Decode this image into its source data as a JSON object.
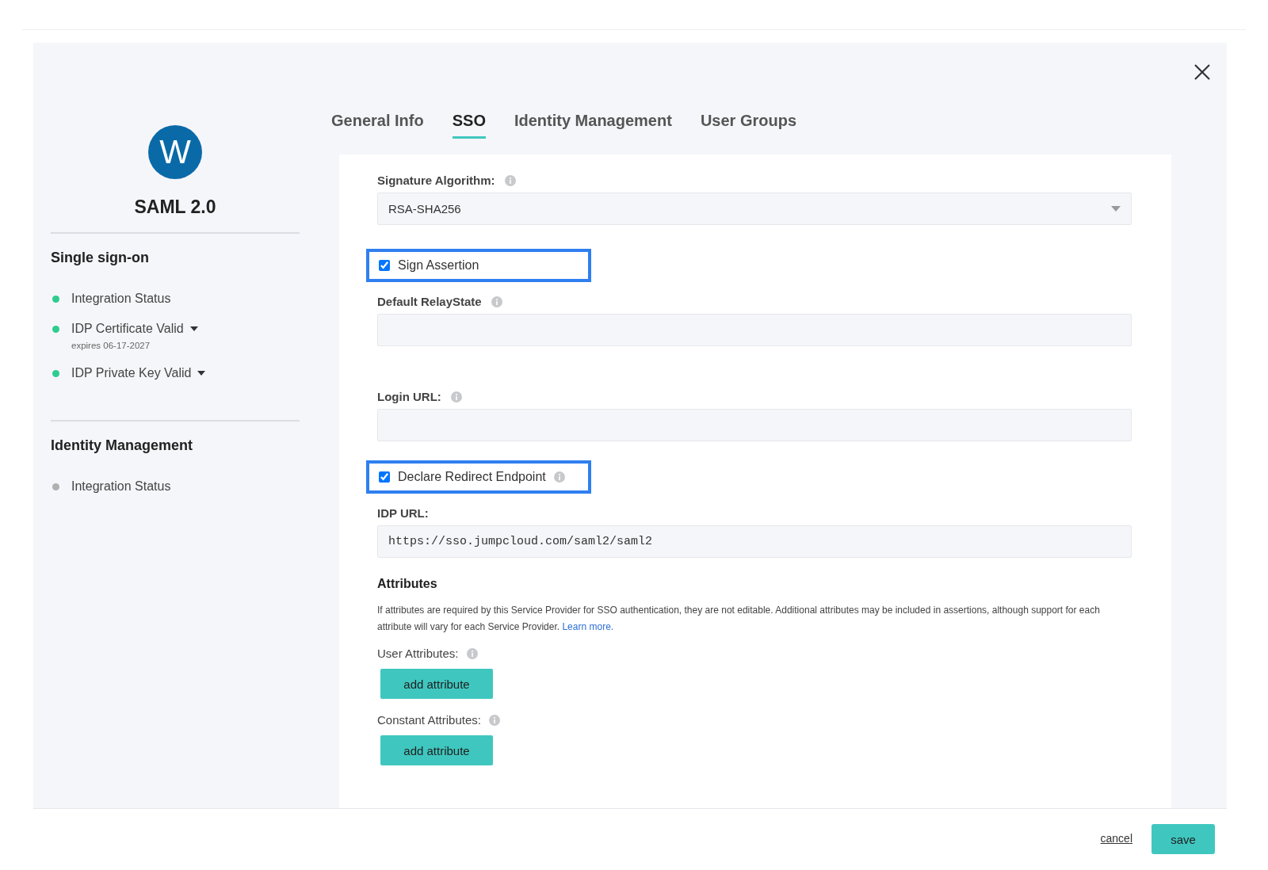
{
  "app": {
    "avatar_letter": "W",
    "title": "SAML 2.0"
  },
  "sidebar": {
    "sections": [
      {
        "title": "Single sign-on",
        "items": [
          {
            "label": "Integration Status",
            "color": "#2ecc8f",
            "dropdown": false
          },
          {
            "label": "IDP Certificate Valid",
            "color": "#2ecc8f",
            "dropdown": true,
            "sublabel": "expires 06-17-2027"
          },
          {
            "label": "IDP Private Key Valid",
            "color": "#2ecc8f",
            "dropdown": true
          }
        ]
      },
      {
        "title": "Identity Management",
        "items": [
          {
            "label": "Integration Status",
            "color": "#b0b0b0",
            "dropdown": false
          }
        ]
      }
    ]
  },
  "tabs": [
    {
      "label": "General Info",
      "selected": false
    },
    {
      "label": "SSO",
      "selected": true
    },
    {
      "label": "Identity Management",
      "selected": false
    },
    {
      "label": "User Groups",
      "selected": false
    }
  ],
  "fields": [
    {
      "kind": "select",
      "label": "Signature Algorithm:",
      "info": true,
      "value": "RSA-SHA256"
    },
    {
      "kind": "checkbox",
      "label": "Sign Assertion",
      "info": false,
      "checked": true,
      "highlighted": true
    },
    {
      "kind": "text",
      "label": "Default RelayState",
      "info": true
    },
    {
      "kind": "text",
      "label": "Login URL:",
      "info": true
    },
    {
      "kind": "checkbox",
      "label": "Declare Redirect Endpoint",
      "info": true,
      "checked": true,
      "highlighted": true
    },
    {
      "kind": "text",
      "label": "IDP URL:",
      "info": false,
      "value": "https://sso.jumpcloud.com/saml2/saml2"
    }
  ],
  "attributes": {
    "title": "Attributes",
    "description": "If attributes are required by this Service Provider for SSO authentication, they are not editable. Additional attributes may be included in assertions, although support for each attribute will vary for each Service Provider.",
    "link": "Learn more.",
    "groups": [
      {
        "label": "User Attributes:",
        "button": "add attribute"
      },
      {
        "label": "Constant Attributes:",
        "button": "add attribute"
      }
    ]
  },
  "footer": {
    "cancel": "cancel",
    "save": "save"
  }
}
